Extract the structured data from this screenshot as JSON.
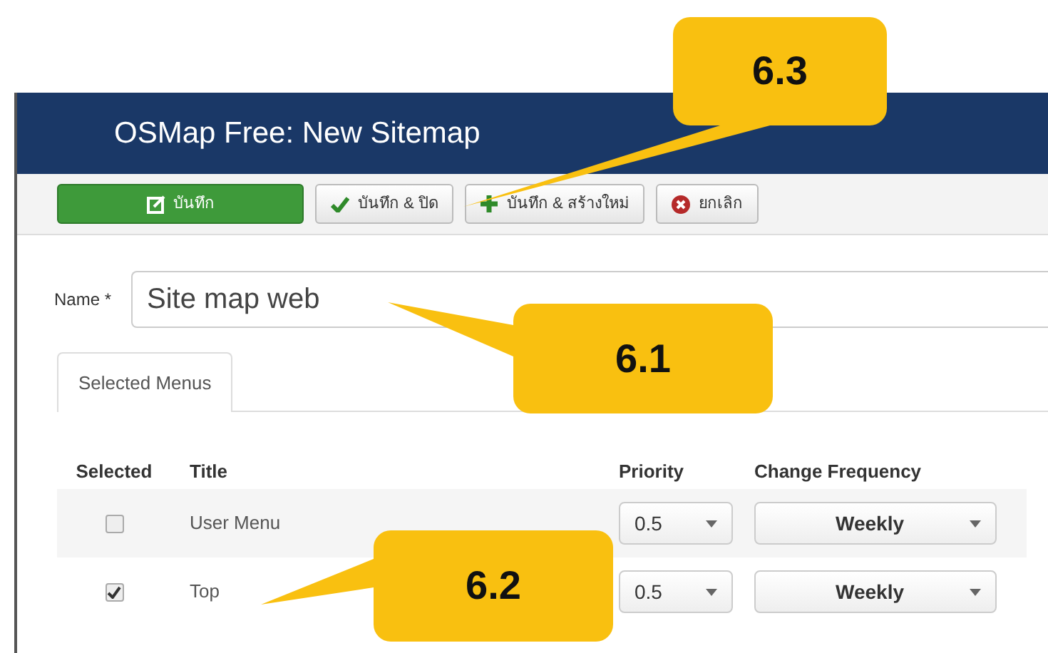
{
  "window": {
    "title": "OSMap Free: New Sitemap"
  },
  "toolbar": [
    {
      "kind": "save",
      "label": "บันทึก"
    },
    {
      "kind": "check",
      "label": "บันทึก & ปิด"
    },
    {
      "kind": "plus",
      "label": "บันทึก & สร้างใหม่"
    },
    {
      "kind": "cancel",
      "label": "ยกเลิก"
    }
  ],
  "name_field": {
    "label": "Name *",
    "value": "Site map web"
  },
  "tabs": [
    {
      "label": "Selected Menus",
      "selected": true
    }
  ],
  "table": {
    "columns": [
      "Selected",
      "Title",
      "Priority",
      "Change Frequency"
    ],
    "rows": [
      {
        "checked": false,
        "title": "User Menu",
        "priority": "0.5",
        "frequency": "Weekly"
      },
      {
        "checked": true,
        "title": "Top",
        "priority": "0.5",
        "frequency": "Weekly"
      }
    ]
  },
  "callouts": [
    {
      "label": "6.3"
    },
    {
      "label": "6.1"
    },
    {
      "label": "6.2"
    }
  ]
}
